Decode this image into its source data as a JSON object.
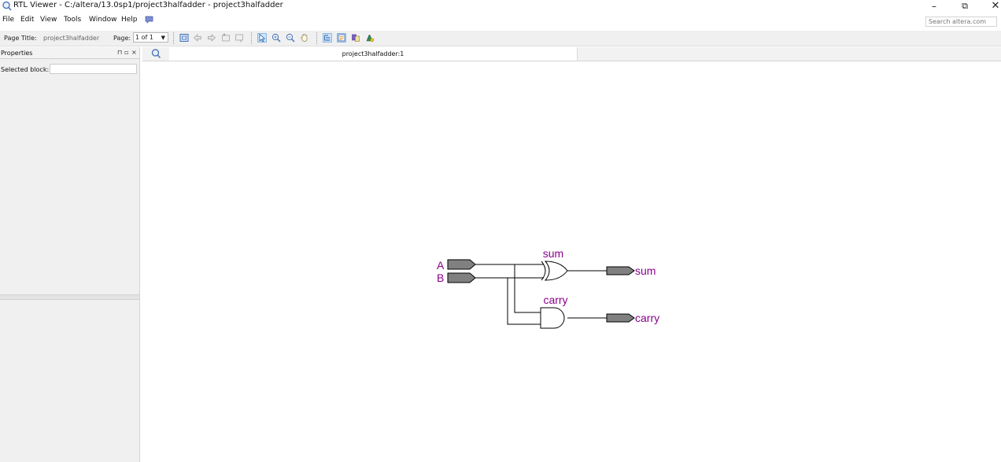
{
  "window": {
    "title": "RTL Viewer - C:/altera/13.0sp1/project3halfadder - project3halfadder",
    "controls": {
      "minimize": "–",
      "maximize": "⧉",
      "close": "✕"
    }
  },
  "menu": {
    "items": [
      "File",
      "Edit",
      "View",
      "Tools",
      "Window",
      "Help"
    ],
    "search_placeholder": "Search altera.com"
  },
  "toolbar": {
    "page_title_label": "Page Title:",
    "page_title_value": "project3halfadder",
    "page_label": "Page:",
    "page_value": "1 of 1",
    "icons": [
      "fit-page-icon",
      "back-icon",
      "forward-icon",
      "go-up-icon",
      "go-down-icon",
      "select-icon",
      "zoom-in-icon",
      "zoom-out-icon",
      "hand-pan-icon",
      "hierarchy-icon",
      "properties-icon",
      "filter-icon",
      "netlist-navigator-icon"
    ]
  },
  "properties_panel": {
    "title": "Properties",
    "header_controls": [
      "⊓",
      "▫",
      "×"
    ],
    "selected_block_label": "Selected block:",
    "selected_block_value": ""
  },
  "tab": {
    "label": "project3halfadder:1"
  },
  "schematic": {
    "inputs": [
      "A",
      "B"
    ],
    "gates": [
      {
        "name": "sum",
        "type": "xor"
      },
      {
        "name": "carry",
        "type": "and"
      }
    ],
    "outputs": [
      "sum",
      "carry"
    ],
    "colors": {
      "label": "#8b008b",
      "pin_fill": "#808080",
      "wire": "#000000"
    }
  }
}
